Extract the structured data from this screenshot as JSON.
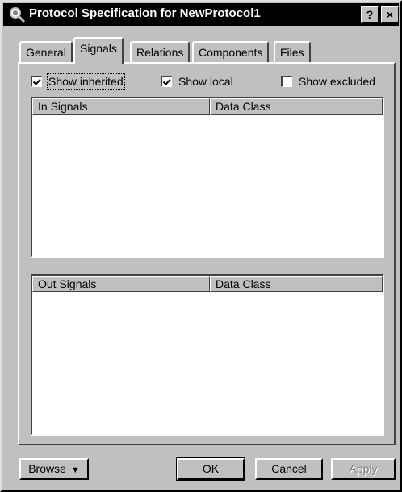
{
  "window": {
    "title": "Protocol Specification for NewProtocol1",
    "help_label": "?",
    "close_label": "×"
  },
  "tabs": [
    {
      "label": "General",
      "active": false
    },
    {
      "label": "Signals",
      "active": true
    },
    {
      "label": "Relations",
      "active": false
    },
    {
      "label": "Components",
      "active": false
    },
    {
      "label": "Files",
      "active": false
    }
  ],
  "filters": {
    "show_inherited": {
      "label": "Show inherited",
      "checked": true
    },
    "show_local": {
      "label": "Show local",
      "checked": true
    },
    "show_excluded": {
      "label": "Show excluded",
      "checked": false
    }
  },
  "in_signals": {
    "columns": [
      "In Signals",
      "Data Class"
    ],
    "rows": []
  },
  "out_signals": {
    "columns": [
      "Out Signals",
      "Data Class"
    ],
    "rows": []
  },
  "buttons": {
    "browse": "Browse",
    "ok": "OK",
    "cancel": "Cancel",
    "apply": "Apply"
  },
  "icons": {
    "title": "magnifier-icon",
    "browse_dropdown": "triangle-down-icon"
  }
}
